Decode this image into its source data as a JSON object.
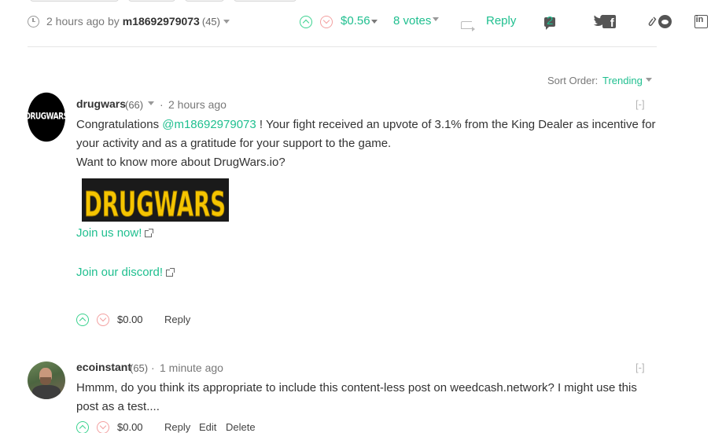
{
  "post_footer": {
    "time": "2 hours ago",
    "by_label": "by",
    "author": "m18692979073",
    "reputation": "(45)",
    "payout": "$0.56",
    "votes": "8 votes",
    "reply_label": "Reply",
    "comment_count": "2"
  },
  "sort": {
    "label": "Sort Order:",
    "value": "Trending"
  },
  "comments": [
    {
      "author": "drugwars",
      "reputation": "(66)",
      "time": "2 hours ago",
      "collapse": "[-]",
      "avatar_text": "DRUGWARS",
      "body_pre": "Congratulations ",
      "mention": "@m18692979073",
      "body_line1": " ! Your fight received an upvote of 3.1% from the King Dealer as incentive for",
      "body_line2": "your activity and as a gratitude for your support to the game.",
      "body_line3": "Want to know more about DrugWars.io?",
      "logo_text": "DRUGWARS",
      "link1": "Join us now!",
      "link2": "Join our discord!",
      "payout": "$0.00",
      "reply_label": "Reply"
    },
    {
      "author": "ecoinstant",
      "reputation": "(65)",
      "time": "1 minute ago",
      "collapse": "[-]",
      "body_line1": "Hmmm, do you think its appropriate to include this content-less post on weedcash.network? I might use this",
      "body_line2": "post as a test....",
      "payout": "$0.00",
      "reply_label": "Reply",
      "edit_label": "Edit",
      "delete_label": "Delete"
    }
  ],
  "colors": {
    "accent": "#1fbf8f",
    "upvote": "#3ad28f",
    "downvote": "#f3a0a0",
    "logo_yellow": "#f5c400"
  }
}
